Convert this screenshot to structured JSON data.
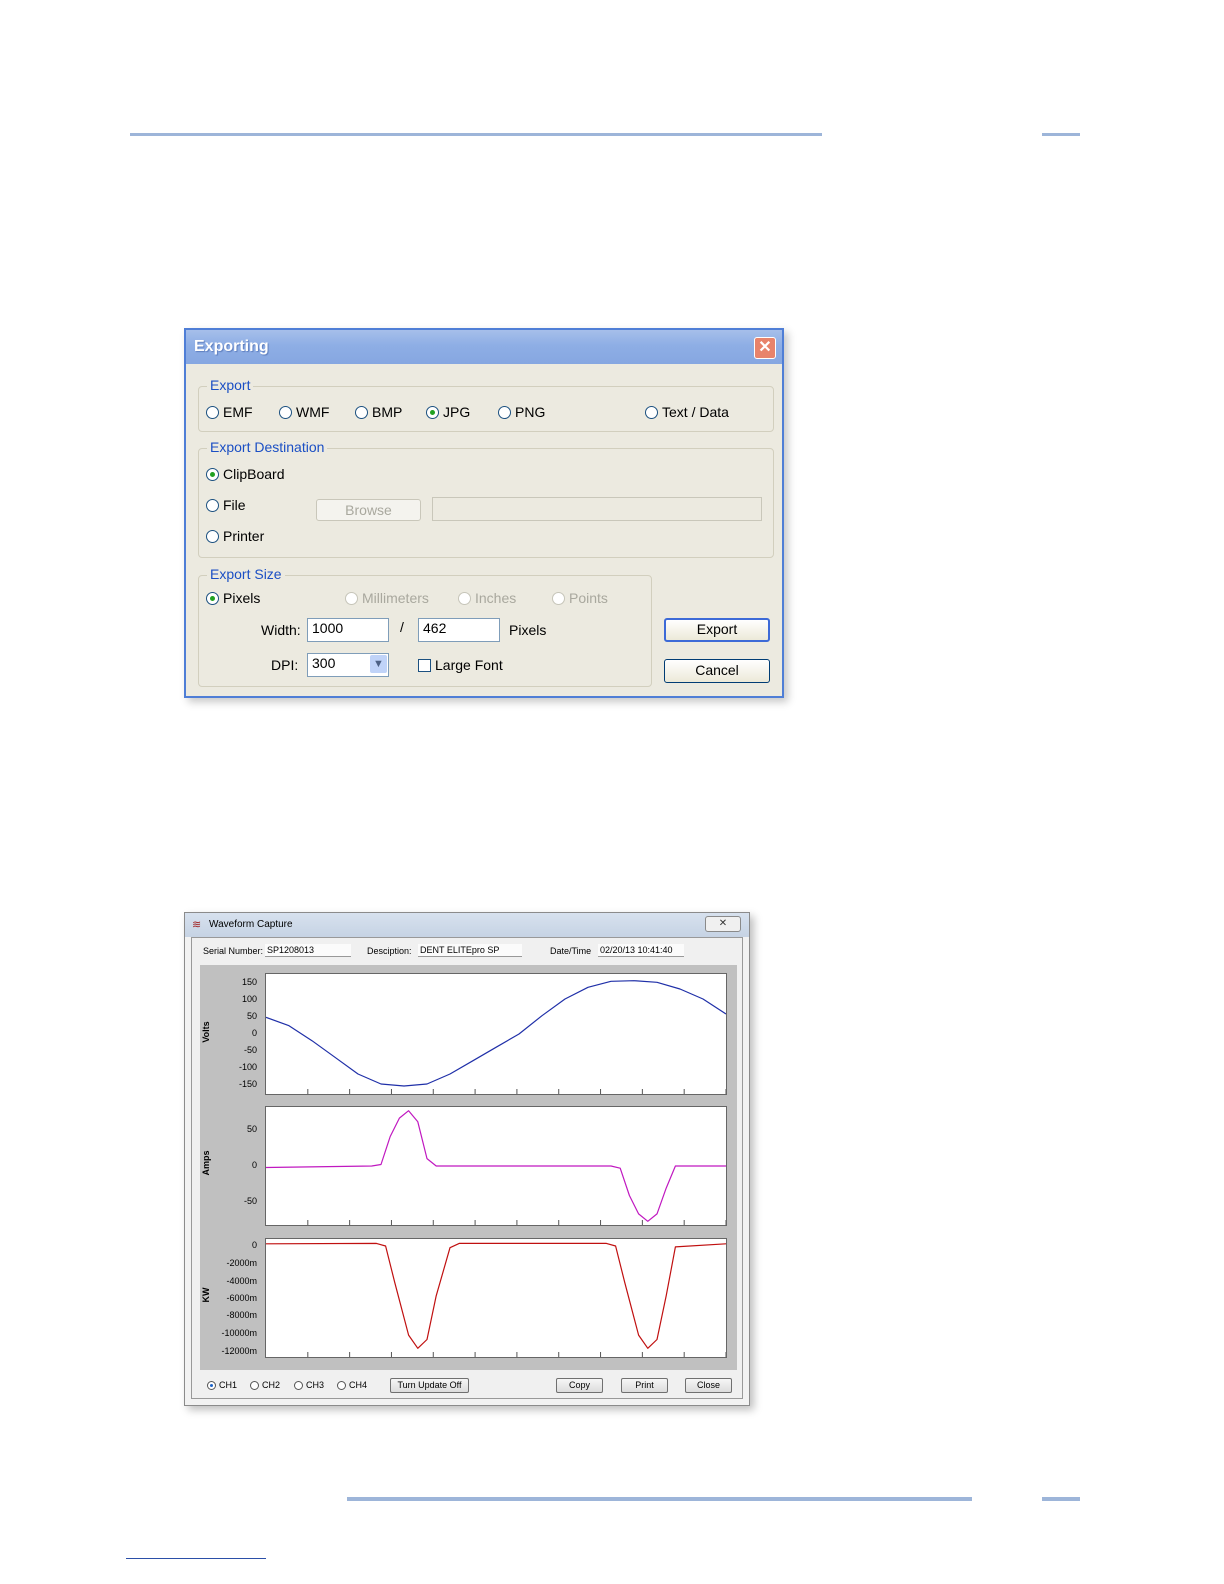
{
  "export_dialog": {
    "title": "Exporting",
    "close_glyph": "✕",
    "export_group": {
      "legend": "Export",
      "formats": [
        "EMF",
        "WMF",
        "BMP",
        "JPG",
        "PNG",
        "Text / Data"
      ],
      "selected": "JPG"
    },
    "destination_group": {
      "legend": "Export Destination",
      "options": [
        "ClipBoard",
        "File",
        "Printer"
      ],
      "selected": "ClipBoard",
      "browse_label": "Browse",
      "file_path_value": ""
    },
    "size_group": {
      "legend": "Export Size",
      "units": [
        "Pixels",
        "Millimeters",
        "Inches",
        "Points"
      ],
      "selected": "Pixels",
      "width_label": "Width:",
      "width_value": "1000",
      "separator": "/",
      "height_value": "462",
      "units_suffix": "Pixels",
      "dpi_label": "DPI:",
      "dpi_value": "300",
      "large_font_label": "Large Font"
    },
    "export_button": "Export",
    "cancel_button": "Cancel"
  },
  "waveform_window": {
    "title": "Waveform Capture",
    "close_glyph": "✕",
    "serial_label": "Serial Number:",
    "serial_value": "SP1208013",
    "description_label": "Desciption:",
    "description_value": "DENT ELITEpro SP",
    "datetime_label": "Date/Time",
    "datetime_value": "02/20/13 10:41:40",
    "channels": [
      "CH1",
      "CH2",
      "CH3",
      "CH4"
    ],
    "selected_channel": "CH1",
    "turn_update_button": "Turn Update Off",
    "copy_button": "Copy",
    "print_button": "Print",
    "close_button": "Close"
  },
  "chart_data": [
    {
      "type": "line",
      "ylabel": "Volts",
      "yticks": [
        "150",
        "100",
        "50",
        "0",
        "-50",
        "-100",
        "-150"
      ],
      "ylim": [
        -180,
        180
      ],
      "series": [
        {
          "color": "#1f2fa8",
          "x": [
            0,
            0.05,
            0.1,
            0.15,
            0.2,
            0.25,
            0.3,
            0.35,
            0.4,
            0.45,
            0.5,
            0.55,
            0.6,
            0.65,
            0.7,
            0.75,
            0.8,
            0.85,
            0.9,
            0.95,
            1.0
          ],
          "y": [
            50,
            25,
            -20,
            -70,
            -120,
            -150,
            -156,
            -150,
            -120,
            -80,
            -40,
            0,
            55,
            105,
            140,
            158,
            160,
            155,
            135,
            105,
            60
          ]
        }
      ]
    },
    {
      "type": "line",
      "ylabel": "Amps",
      "yticks": [
        "50",
        "0",
        "-50"
      ],
      "ylim": [
        -80,
        80
      ],
      "series": [
        {
          "color": "#c018c0",
          "x": [
            0,
            0.23,
            0.25,
            0.27,
            0.29,
            0.31,
            0.33,
            0.35,
            0.37,
            0.75,
            0.77,
            0.79,
            0.81,
            0.83,
            0.85,
            0.87,
            0.89,
            1.0
          ],
          "y": [
            -2,
            0,
            2,
            40,
            65,
            75,
            60,
            10,
            0,
            0,
            -3,
            -40,
            -65,
            -75,
            -65,
            -30,
            0,
            0
          ]
        }
      ]
    },
    {
      "type": "line",
      "ylabel": "KW",
      "yticks": [
        "0",
        "-2000m",
        "-4000m",
        "-6000m",
        "-8000m",
        "-10000m",
        "-12000m"
      ],
      "ylim": [
        -13000,
        500
      ],
      "series": [
        {
          "color": "#c01010",
          "x": [
            0,
            0.24,
            0.26,
            0.28,
            0.31,
            0.33,
            0.35,
            0.37,
            0.4,
            0.42,
            0.74,
            0.76,
            0.78,
            0.81,
            0.83,
            0.85,
            0.87,
            0.89,
            1.0
          ],
          "y": [
            -50,
            0,
            -300,
            -4500,
            -10500,
            -12000,
            -11000,
            -6000,
            -500,
            0,
            0,
            -300,
            -4500,
            -10500,
            -12000,
            -11000,
            -6000,
            -400,
            -50
          ]
        }
      ]
    }
  ]
}
